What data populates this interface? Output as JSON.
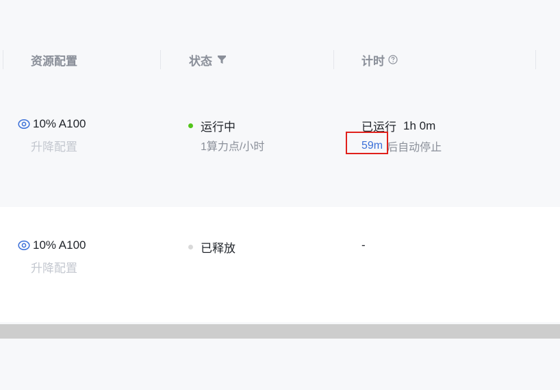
{
  "table": {
    "columns": {
      "resource": "资源配置",
      "status": "状态",
      "timer": "计时"
    },
    "rows": [
      {
        "spec": "10% A100",
        "resize": "升降配置",
        "status": "运行中",
        "status_color": "#52c41a",
        "rate": "1算力点/小时",
        "timer_label": "已运行",
        "timer_value": "1h 0m",
        "auto_stop_minutes": "59m",
        "auto_stop_suffix": "后自动停止"
      },
      {
        "spec": "10% A100",
        "resize": "升降配置",
        "status": "已释放",
        "status_color": "#d9d9d9",
        "timer": "-"
      }
    ]
  },
  "icons": {
    "view": "eye-icon",
    "filter": "filter-icon",
    "help": "question-circle-icon"
  },
  "colors": {
    "accent": "#3a6fd8",
    "highlight": "#e0201b",
    "running": "#52c41a",
    "released": "#d9d9d9"
  }
}
